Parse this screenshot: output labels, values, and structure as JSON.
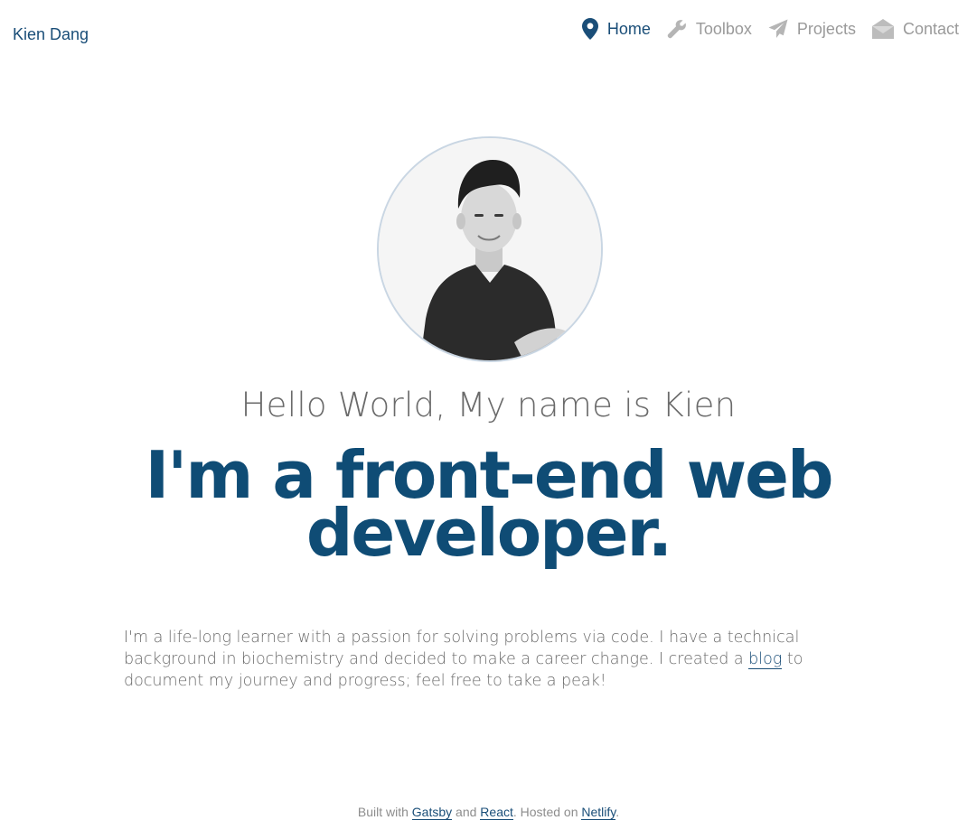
{
  "header": {
    "brand": "Kien Dang",
    "nav": [
      {
        "label": "Home",
        "icon": "map-marker-icon",
        "active": true
      },
      {
        "label": "Toolbox",
        "icon": "wrench-icon",
        "active": false
      },
      {
        "label": "Projects",
        "icon": "paper-plane-icon",
        "active": false
      },
      {
        "label": "Contact",
        "icon": "envelope-open-icon",
        "active": false
      }
    ]
  },
  "hero": {
    "greeting": "Hello World, My name is Kien",
    "tagline": "I'm a front-end web developer."
  },
  "bio": {
    "text_before": "I'm a life-long learner with a passion for solving problems via code. I have a technical background in biochemistry and decided to make a career change. I created a ",
    "link": "blog",
    "text_after": " to document my journey and progress; feel free to take a peak!"
  },
  "footer": {
    "t1": "Built with ",
    "l1": "Gatsby",
    "t2": " and ",
    "l2": "React",
    "t3": ". Hosted on ",
    "l3": "Netlify",
    "t4": "."
  },
  "colors": {
    "accent": "#0f4c75",
    "nav_inactive": "#9a9a9a",
    "text": "#6b6b6b"
  }
}
